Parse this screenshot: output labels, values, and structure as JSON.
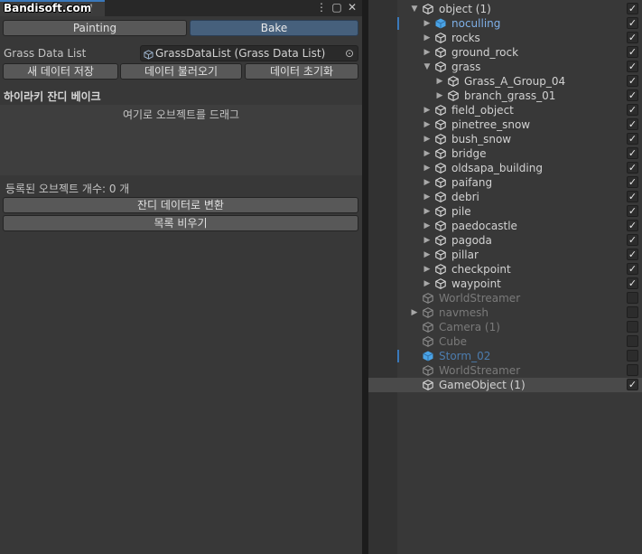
{
  "watermark": "Bandisoft.com",
  "left_tab": {
    "title_fragment": "ol"
  },
  "window_icons": {
    "menu": "⋮",
    "maximize": "▢",
    "close": "✕"
  },
  "mode_tabs": {
    "painting": "Painting",
    "bake": "Bake"
  },
  "grass_data": {
    "label": "Grass Data List",
    "value": "GrassDataList (Grass Data List)",
    "icon": "scriptable-object-icon",
    "picker_icon": "⊙"
  },
  "data_buttons": {
    "save": "새 데이터 저장",
    "load": "데이터 불러오기",
    "reset": "데이터 초기화"
  },
  "section": {
    "title": "하이라키 잔디 베이크",
    "drop_hint": "여기로 오브젝트를 드래그"
  },
  "registered": {
    "text": "등록된 오브젝트 개수: 0 개"
  },
  "actions": {
    "convert": "잔디 데이터로 변환",
    "clear": "목록 비우기"
  },
  "hierarchy": {
    "rows": [
      {
        "label": "object (1)",
        "indent": 0,
        "arrow": "down",
        "icon": "cube",
        "checked": true,
        "active": true
      },
      {
        "label": "noculling",
        "indent": 1,
        "arrow": "right",
        "icon": "prefab",
        "checked": true,
        "active": true,
        "prefab": true,
        "modified": true
      },
      {
        "label": "rocks",
        "indent": 1,
        "arrow": "right",
        "icon": "cube",
        "checked": true,
        "active": true
      },
      {
        "label": "ground_rock",
        "indent": 1,
        "arrow": "right",
        "icon": "cube",
        "checked": true,
        "active": true
      },
      {
        "label": "grass",
        "indent": 1,
        "arrow": "down",
        "icon": "cube",
        "checked": true,
        "active": true
      },
      {
        "label": "Grass_A_Group_04",
        "indent": 2,
        "arrow": "right",
        "icon": "cube",
        "checked": true,
        "active": true
      },
      {
        "label": "branch_grass_01",
        "indent": 2,
        "arrow": "right",
        "icon": "cube",
        "checked": true,
        "active": true
      },
      {
        "label": "field_object",
        "indent": 1,
        "arrow": "right",
        "icon": "cube",
        "checked": true,
        "active": true
      },
      {
        "label": "pinetree_snow",
        "indent": 1,
        "arrow": "right",
        "icon": "cube",
        "checked": true,
        "active": true
      },
      {
        "label": "bush_snow",
        "indent": 1,
        "arrow": "right",
        "icon": "cube",
        "checked": true,
        "active": true
      },
      {
        "label": "bridge",
        "indent": 1,
        "arrow": "right",
        "icon": "cube",
        "checked": true,
        "active": true
      },
      {
        "label": "oldsapa_building",
        "indent": 1,
        "arrow": "right",
        "icon": "cube",
        "checked": true,
        "active": true
      },
      {
        "label": "paifang",
        "indent": 1,
        "arrow": "right",
        "icon": "cube",
        "checked": true,
        "active": true
      },
      {
        "label": "debri",
        "indent": 1,
        "arrow": "right",
        "icon": "cube",
        "checked": true,
        "active": true
      },
      {
        "label": "pile",
        "indent": 1,
        "arrow": "right",
        "icon": "cube",
        "checked": true,
        "active": true
      },
      {
        "label": "paedocastle",
        "indent": 1,
        "arrow": "right",
        "icon": "cube",
        "checked": true,
        "active": true
      },
      {
        "label": "pagoda",
        "indent": 1,
        "arrow": "right",
        "icon": "cube",
        "checked": true,
        "active": true
      },
      {
        "label": "pillar",
        "indent": 1,
        "arrow": "right",
        "icon": "cube",
        "checked": true,
        "active": true
      },
      {
        "label": "checkpoint",
        "indent": 1,
        "arrow": "right",
        "icon": "cube",
        "checked": true,
        "active": true
      },
      {
        "label": "waypoint",
        "indent": 1,
        "arrow": "right",
        "icon": "cube",
        "checked": true,
        "active": true
      },
      {
        "label": "WorldStreamer",
        "indent": 0,
        "arrow": "none",
        "icon": "cube",
        "checked": false,
        "active": false
      },
      {
        "label": "navmesh",
        "indent": 0,
        "arrow": "right",
        "icon": "cube",
        "checked": false,
        "active": false
      },
      {
        "label": "Camera (1)",
        "indent": 0,
        "arrow": "none",
        "icon": "cube",
        "checked": false,
        "active": false
      },
      {
        "label": "Cube",
        "indent": 0,
        "arrow": "none",
        "icon": "cube",
        "checked": false,
        "active": false
      },
      {
        "label": "Storm_02",
        "indent": 0,
        "arrow": "none",
        "icon": "prefab",
        "checked": false,
        "active": false,
        "prefab": true,
        "modified": true
      },
      {
        "label": "WorldStreamer",
        "indent": 0,
        "arrow": "none",
        "icon": "cube",
        "checked": false,
        "active": false
      },
      {
        "label": "GameObject (1)",
        "indent": 0,
        "arrow": "none",
        "icon": "cube",
        "checked": true,
        "active": true,
        "selected": true
      }
    ]
  },
  "colors": {
    "accent": "#3a79bb",
    "prefab_text": "#7fb0e8",
    "prefab_inactive_text": "#4c7cae",
    "active_text": "#d2d2d2",
    "inactive_text": "#7a7a7a"
  }
}
